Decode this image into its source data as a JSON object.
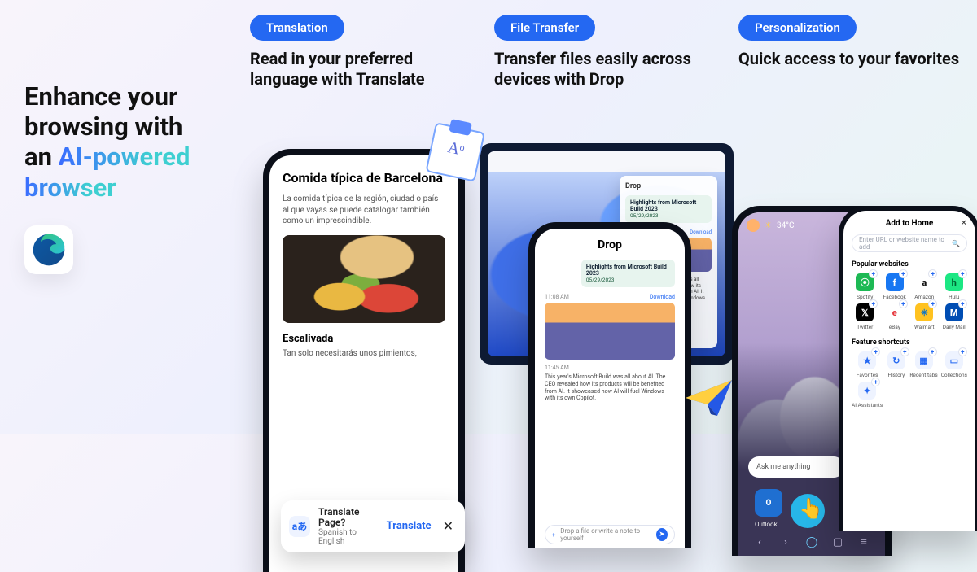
{
  "intro": {
    "line1": "Enhance your",
    "line2": "browsing with",
    "line3_a": "an ",
    "line3_b": "AI-powered",
    "line4": "browser"
  },
  "translation": {
    "pill": "Translation",
    "title": "Read in your preferred language with Translate",
    "article_title": "Comida típica de Barcelona",
    "article_body": "La comida típica de la región, ciudad o país al que vayas se puede catalogar también como un imprescindible.",
    "sub_title": "Escalivada",
    "sub_body": "Tan solo necesitarás unos pimientos,",
    "bar_question": "Translate Page?",
    "bar_sub": "Spanish to English",
    "bar_action": "Translate",
    "clipboard_glyph": "Aᵒ"
  },
  "transfer": {
    "pill": "File Transfer",
    "title": "Transfer files easily across devices with Drop",
    "panel_title": "Drop",
    "chip_title": "Highlights from Microsoft Build 2023",
    "chip_date": "05/29/2023",
    "time1": "11:08 AM",
    "download": "Download",
    "time2": "11:45 AM",
    "blurb": "This year's Microsoft Build was all about AI. The CEO revealed how its products will be benefited from AI. It showcased how AI will fuel Windows with its own Copilot.",
    "input_placeholder": "Drop a file or write a note to yourself"
  },
  "personal": {
    "pill": "Personalization",
    "title": "Quick access to your favorites",
    "temp": "34°C",
    "ask": "Ask me anything",
    "outlook": "Outlook",
    "add_home": "Add to Home",
    "search_placeholder": "Enter URL or website name to add",
    "popular": "Popular websites",
    "apps": [
      {
        "name": "Spotify",
        "bg": "#1db954",
        "g": "⦿"
      },
      {
        "name": "Facebook",
        "bg": "#1877f2",
        "g": "f"
      },
      {
        "name": "Amazon",
        "bg": "#fff",
        "fg": "#111",
        "g": "a"
      },
      {
        "name": "Hulu",
        "bg": "#1ce783",
        "fg": "#063",
        "g": "h"
      },
      {
        "name": "Twitter",
        "bg": "#000",
        "g": "𝕏"
      },
      {
        "name": "eBay",
        "bg": "#fff",
        "fg": "#e53238",
        "g": "e"
      },
      {
        "name": "Walmart",
        "bg": "#ffc220",
        "fg": "#0071ce",
        "g": "✳"
      },
      {
        "name": "Daily Mail",
        "bg": "#004db3",
        "g": "M"
      }
    ],
    "shortcuts_label": "Feature shortcuts",
    "shortcuts": [
      {
        "name": "Favorites",
        "g": "★"
      },
      {
        "name": "History",
        "g": "↻"
      },
      {
        "name": "Recent tabs",
        "g": "▦"
      },
      {
        "name": "Collections",
        "g": "▭"
      },
      {
        "name": "AI Assistants",
        "g": "✦"
      }
    ]
  }
}
